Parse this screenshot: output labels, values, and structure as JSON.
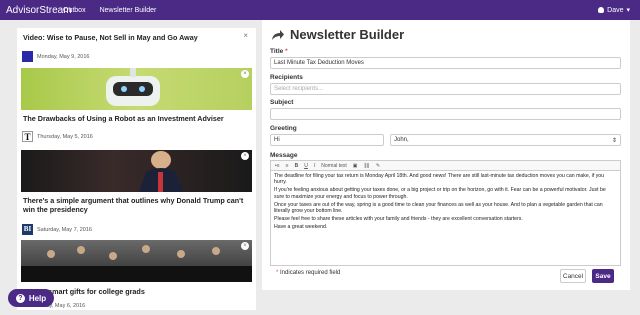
{
  "nav": {
    "brand": "AdvisorStream",
    "links": [
      "Outbox",
      "Newsletter Builder"
    ],
    "user": "Dave"
  },
  "feed": {
    "cards": [
      {
        "title": "Video: Wise to Pause, Not Sell in May and Go Away",
        "date": "Monday, May 9, 2016",
        "source": "BW"
      },
      {
        "title": "The Drawbacks of Using a Robot as an Investment Adviser",
        "date": "Thursday, May 5, 2016",
        "source": "T"
      },
      {
        "title": "There's a simple argument that outlines why Donald Trump can't win the presidency",
        "date": "Saturday, May 7, 2016",
        "source": "BI"
      },
      {
        "title": "Money-smart gifts for college grads",
        "date": "Friday, May 6, 2016",
        "source": ""
      }
    ],
    "close_glyph": "×"
  },
  "help": {
    "label": "Help",
    "icon": "?"
  },
  "builder": {
    "heading": "Newsletter Builder",
    "title_label": "Title",
    "required_mark": "*",
    "title_value": "Last Minute Tax Deduction Moves",
    "recipients_label": "Recipients",
    "recipients_placeholder": "Select recipients...",
    "subject_label": "Subject",
    "subject_value": "",
    "greeting_label": "Greeting",
    "greeting_value": "Hi",
    "greeting_name": "John,",
    "message_label": "Message",
    "toolbar": [
      "•≡",
      "≡",
      "B",
      "U",
      "I",
      "Normal text",
      "▣",
      "⛓",
      "✎"
    ],
    "message": [
      "The deadline for filing your tax return is Monday April 18th. And good news! There are still last-minute tax deduction moves you can make, if you hurry.",
      "If you're feeling anxious about getting your taxes done, or a big project or trip on the horizon, go with it. Fear can be a powerful motivator. Just be sure to maximize your energy and focus to power through.",
      "Once your taxes are out of the way, spring is a good time to clean your finances as well as your house. And to plan a vegetable garden that can literally grow your bottom line.",
      "Please feel free to share these articles with your family and friends - they are excellent conversation starters.",
      "Have a great weekend."
    ],
    "required_note": "Indicates required field",
    "cancel_label": "Cancel",
    "save_label": "Save"
  }
}
